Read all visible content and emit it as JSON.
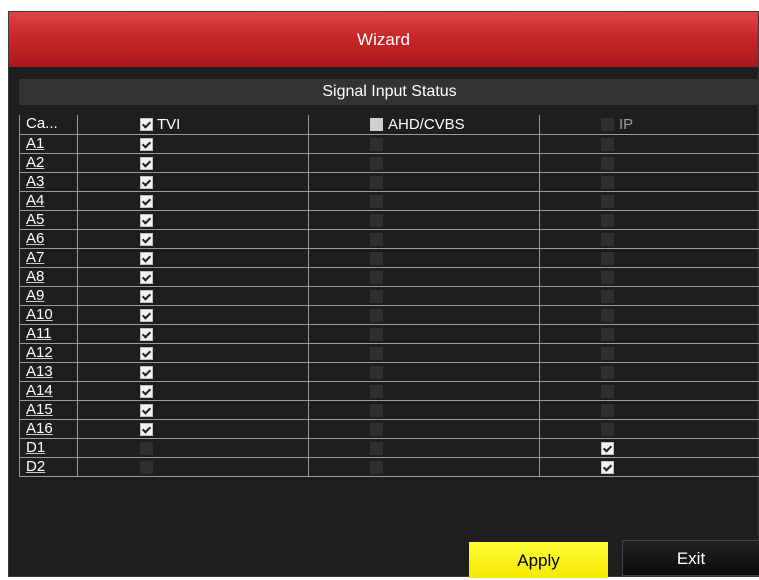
{
  "window": {
    "title": "Wizard"
  },
  "section": {
    "title": "Signal Input Status"
  },
  "table": {
    "headers": {
      "camera": "Ca...",
      "tvi": "TVI",
      "ahd": "AHD/CVBS",
      "ip": "IP"
    },
    "header_checks": {
      "tvi": true,
      "ahd": false,
      "ip": false
    },
    "rows": [
      {
        "camera": "A1",
        "tvi": true,
        "ahd": false,
        "ip": false
      },
      {
        "camera": "A2",
        "tvi": true,
        "ahd": false,
        "ip": false
      },
      {
        "camera": "A3",
        "tvi": true,
        "ahd": false,
        "ip": false
      },
      {
        "camera": "A4",
        "tvi": true,
        "ahd": false,
        "ip": false
      },
      {
        "camera": "A5",
        "tvi": true,
        "ahd": false,
        "ip": false
      },
      {
        "camera": "A6",
        "tvi": true,
        "ahd": false,
        "ip": false
      },
      {
        "camera": "A7",
        "tvi": true,
        "ahd": false,
        "ip": false
      },
      {
        "camera": "A8",
        "tvi": true,
        "ahd": false,
        "ip": false
      },
      {
        "camera": "A9",
        "tvi": true,
        "ahd": false,
        "ip": false
      },
      {
        "camera": "A10",
        "tvi": true,
        "ahd": false,
        "ip": false
      },
      {
        "camera": "A11",
        "tvi": true,
        "ahd": false,
        "ip": false
      },
      {
        "camera": "A12",
        "tvi": true,
        "ahd": false,
        "ip": false
      },
      {
        "camera": "A13",
        "tvi": true,
        "ahd": false,
        "ip": false
      },
      {
        "camera": "A14",
        "tvi": true,
        "ahd": false,
        "ip": false
      },
      {
        "camera": "A15",
        "tvi": true,
        "ahd": false,
        "ip": false
      },
      {
        "camera": "A16",
        "tvi": true,
        "ahd": false,
        "ip": false
      },
      {
        "camera": "D1",
        "tvi": false,
        "ahd": false,
        "ip": true
      },
      {
        "camera": "D2",
        "tvi": false,
        "ahd": false,
        "ip": true
      }
    ]
  },
  "buttons": {
    "apply": "Apply",
    "exit": "Exit"
  },
  "colors": {
    "title_bar": "#c9272a",
    "apply_button": "#ffff3a",
    "background": "#1e1e1e"
  }
}
